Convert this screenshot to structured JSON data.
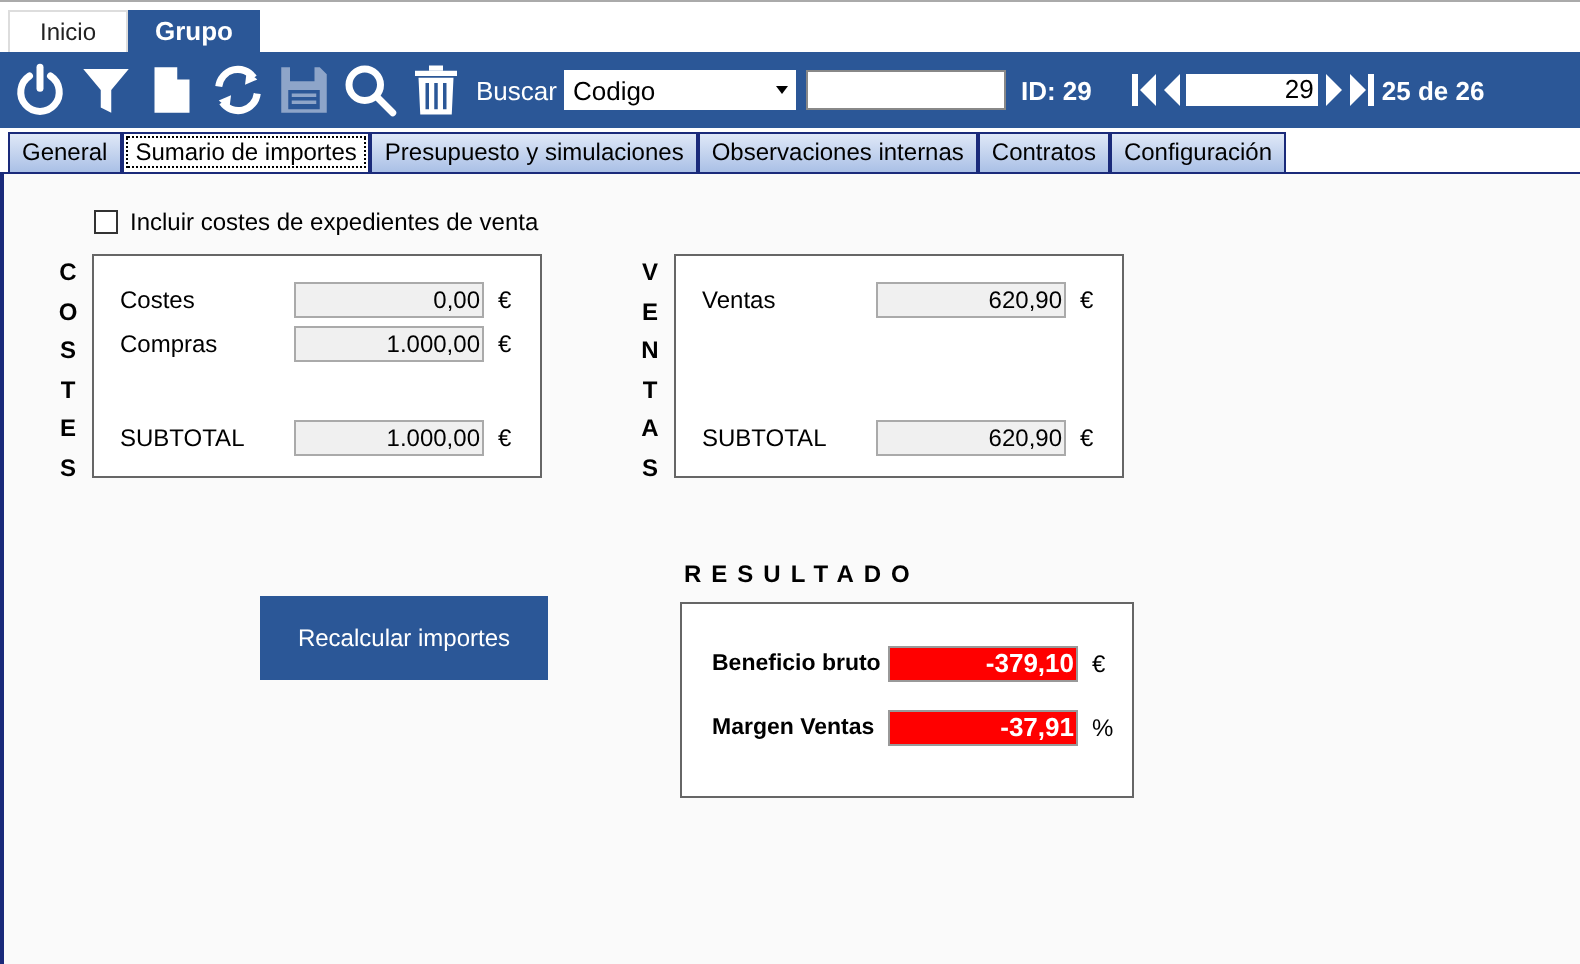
{
  "ribbon_tabs": [
    {
      "label": "Inicio",
      "selected": false
    },
    {
      "label": "Grupo",
      "selected": true
    }
  ],
  "toolbar": {
    "tools": [
      {
        "kind": "power",
        "disabled": false
      },
      {
        "kind": "filter",
        "disabled": false
      },
      {
        "kind": "document",
        "disabled": false
      },
      {
        "kind": "refresh",
        "disabled": false
      },
      {
        "kind": "save",
        "disabled": true
      },
      {
        "kind": "search",
        "disabled": false
      },
      {
        "kind": "trash",
        "disabled": false
      }
    ],
    "search_label": "Buscar",
    "search_field": "Codigo",
    "id_label": "ID: 29",
    "pager_value": "29",
    "pager_count": "25 de 26"
  },
  "tabs": [
    {
      "label": "General",
      "selected": false
    },
    {
      "label": "Sumario de importes",
      "selected": true
    },
    {
      "label": "Presupuesto y simulaciones",
      "selected": false
    },
    {
      "label": "Observaciones internas",
      "selected": false
    },
    {
      "label": "Contratos",
      "selected": false
    },
    {
      "label": "Configuración",
      "selected": false
    }
  ],
  "include_checkbox": {
    "label": "Incluir costes de expedientes de venta",
    "checked": false
  },
  "costes": {
    "title": "COSTES",
    "rows": [
      {
        "label": "Costes",
        "value": "0,00",
        "unit": "€"
      },
      {
        "label": "Compras",
        "value": "1.000,00",
        "unit": "€"
      }
    ],
    "subtotal": {
      "label": "SUBTOTAL",
      "value": "1.000,00",
      "unit": "€"
    }
  },
  "ventas": {
    "title": "VENTAS",
    "rows": [
      {
        "label": "Ventas",
        "value": "620,90",
        "unit": "€"
      }
    ],
    "subtotal": {
      "label": "SUBTOTAL",
      "value": "620,90",
      "unit": "€"
    }
  },
  "recalc_button": "Recalcular importes",
  "resultado": {
    "title": "RESULTADO",
    "rows": [
      {
        "label": "Beneficio bruto",
        "value": "-379,10",
        "unit": "€",
        "negative": true
      },
      {
        "label": "Margen Ventas",
        "value": "-37,91",
        "unit": "%",
        "negative": true
      }
    ]
  }
}
